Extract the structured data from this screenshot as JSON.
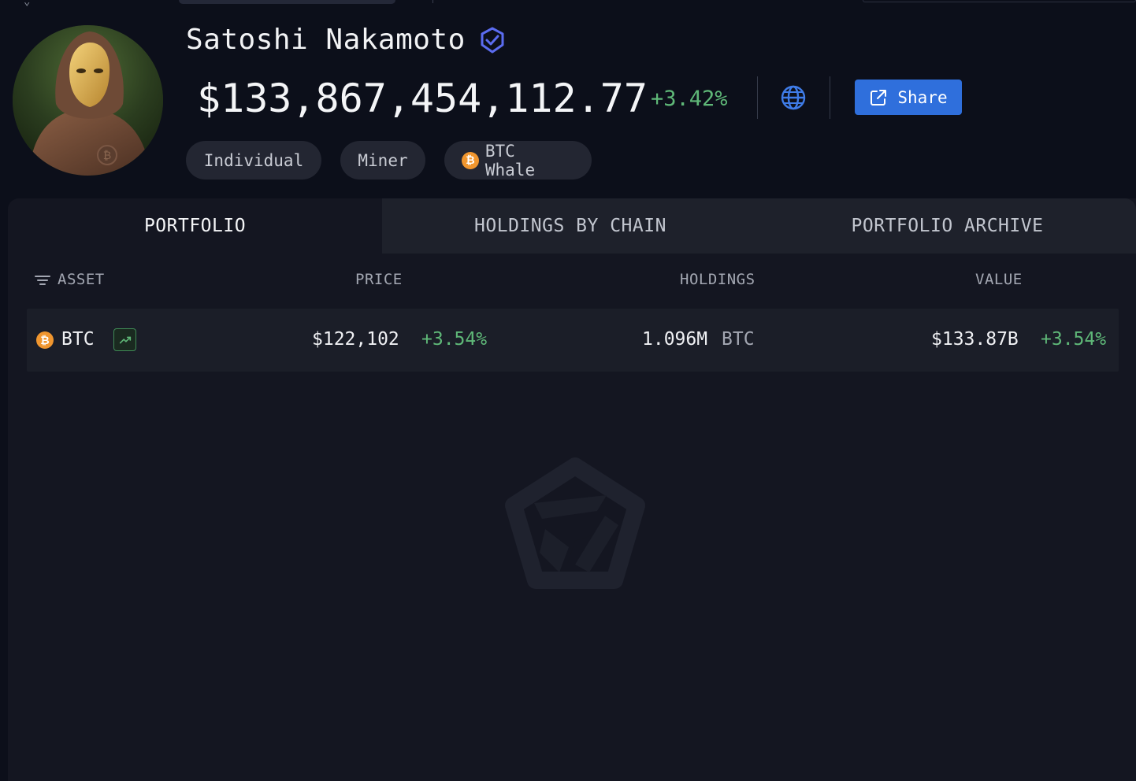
{
  "profile": {
    "name": "Satoshi Nakamoto",
    "balance": "$133,867,454,112.77",
    "balance_change": "+3.42%",
    "share_label": "Share",
    "tags": [
      "Individual",
      "Miner",
      "BTC Whale"
    ]
  },
  "tabs": [
    "PORTFOLIO",
    "HOLDINGS BY CHAIN",
    "PORTFOLIO ARCHIVE"
  ],
  "active_tab": "PORTFOLIO",
  "table": {
    "columns": [
      "ASSET",
      "PRICE",
      "HOLDINGS",
      "VALUE"
    ],
    "rows": [
      {
        "symbol": "BTC",
        "price": "$122,102",
        "price_change": "+3.54%",
        "holdings": "1.096M",
        "holdings_symbol": "BTC",
        "value": "$133.87B",
        "value_change": "+3.54%"
      }
    ]
  },
  "colors": {
    "background": "#0c0f1a",
    "panel": "#141621",
    "accent": "#2f6fdc",
    "positive": "#5fb878",
    "btc": "#f0962f",
    "verified": "#5b6cf0"
  },
  "icons": {
    "verified": "verified-badge-icon",
    "globe": "globe-icon",
    "share": "external-link-icon",
    "filter": "filter-icon",
    "chart": "trend-up-icon",
    "coin": "bitcoin-icon",
    "watermark": "arkham-logo-icon"
  }
}
